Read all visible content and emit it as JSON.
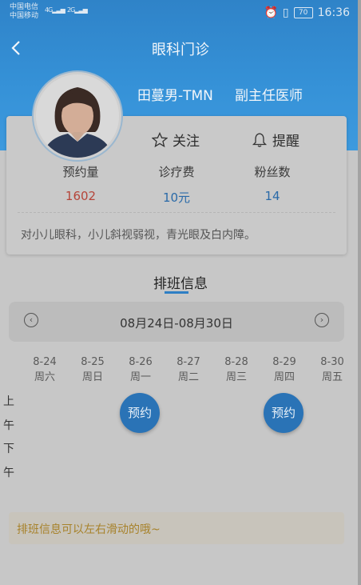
{
  "status_bar": {
    "carrier1": "中国电信",
    "carrier2": "中国移动",
    "signal1": "4G",
    "signal2": "2G",
    "battery": "70",
    "time": "16:36"
  },
  "nav": {
    "title": "眼科门诊"
  },
  "doctor": {
    "name": "田蔓男-TMN",
    "title": "副主任医师",
    "follow_label": "关注",
    "remind_label": "提醒",
    "stats": [
      {
        "label": "预约量",
        "value": "1602",
        "color": "#b5453a"
      },
      {
        "label": "诊疗费",
        "value": "10元",
        "color": "#2a6aa8"
      },
      {
        "label": "粉丝数",
        "value": "14",
        "color": "#2a6aa8"
      }
    ],
    "description": "对小儿眼科，小儿斜视弱视，青光眼及白内障。"
  },
  "schedule": {
    "title": "排班信息",
    "week_range": "08月24日-08月30日",
    "days": [
      {
        "date": "8-24",
        "weekday": "周六"
      },
      {
        "date": "8-25",
        "weekday": "周日"
      },
      {
        "date": "8-26",
        "weekday": "周一"
      },
      {
        "date": "8-27",
        "weekday": "周二"
      },
      {
        "date": "8-28",
        "weekday": "周三"
      },
      {
        "date": "8-29",
        "weekday": "周四"
      },
      {
        "date": "8-30",
        "weekday": "周五"
      }
    ],
    "row_labels": {
      "morning": [
        "上",
        "午"
      ],
      "afternoon": [
        "下",
        "午"
      ]
    },
    "book_label": "预约",
    "tip": "排班信息可以左右滑动的哦~"
  }
}
